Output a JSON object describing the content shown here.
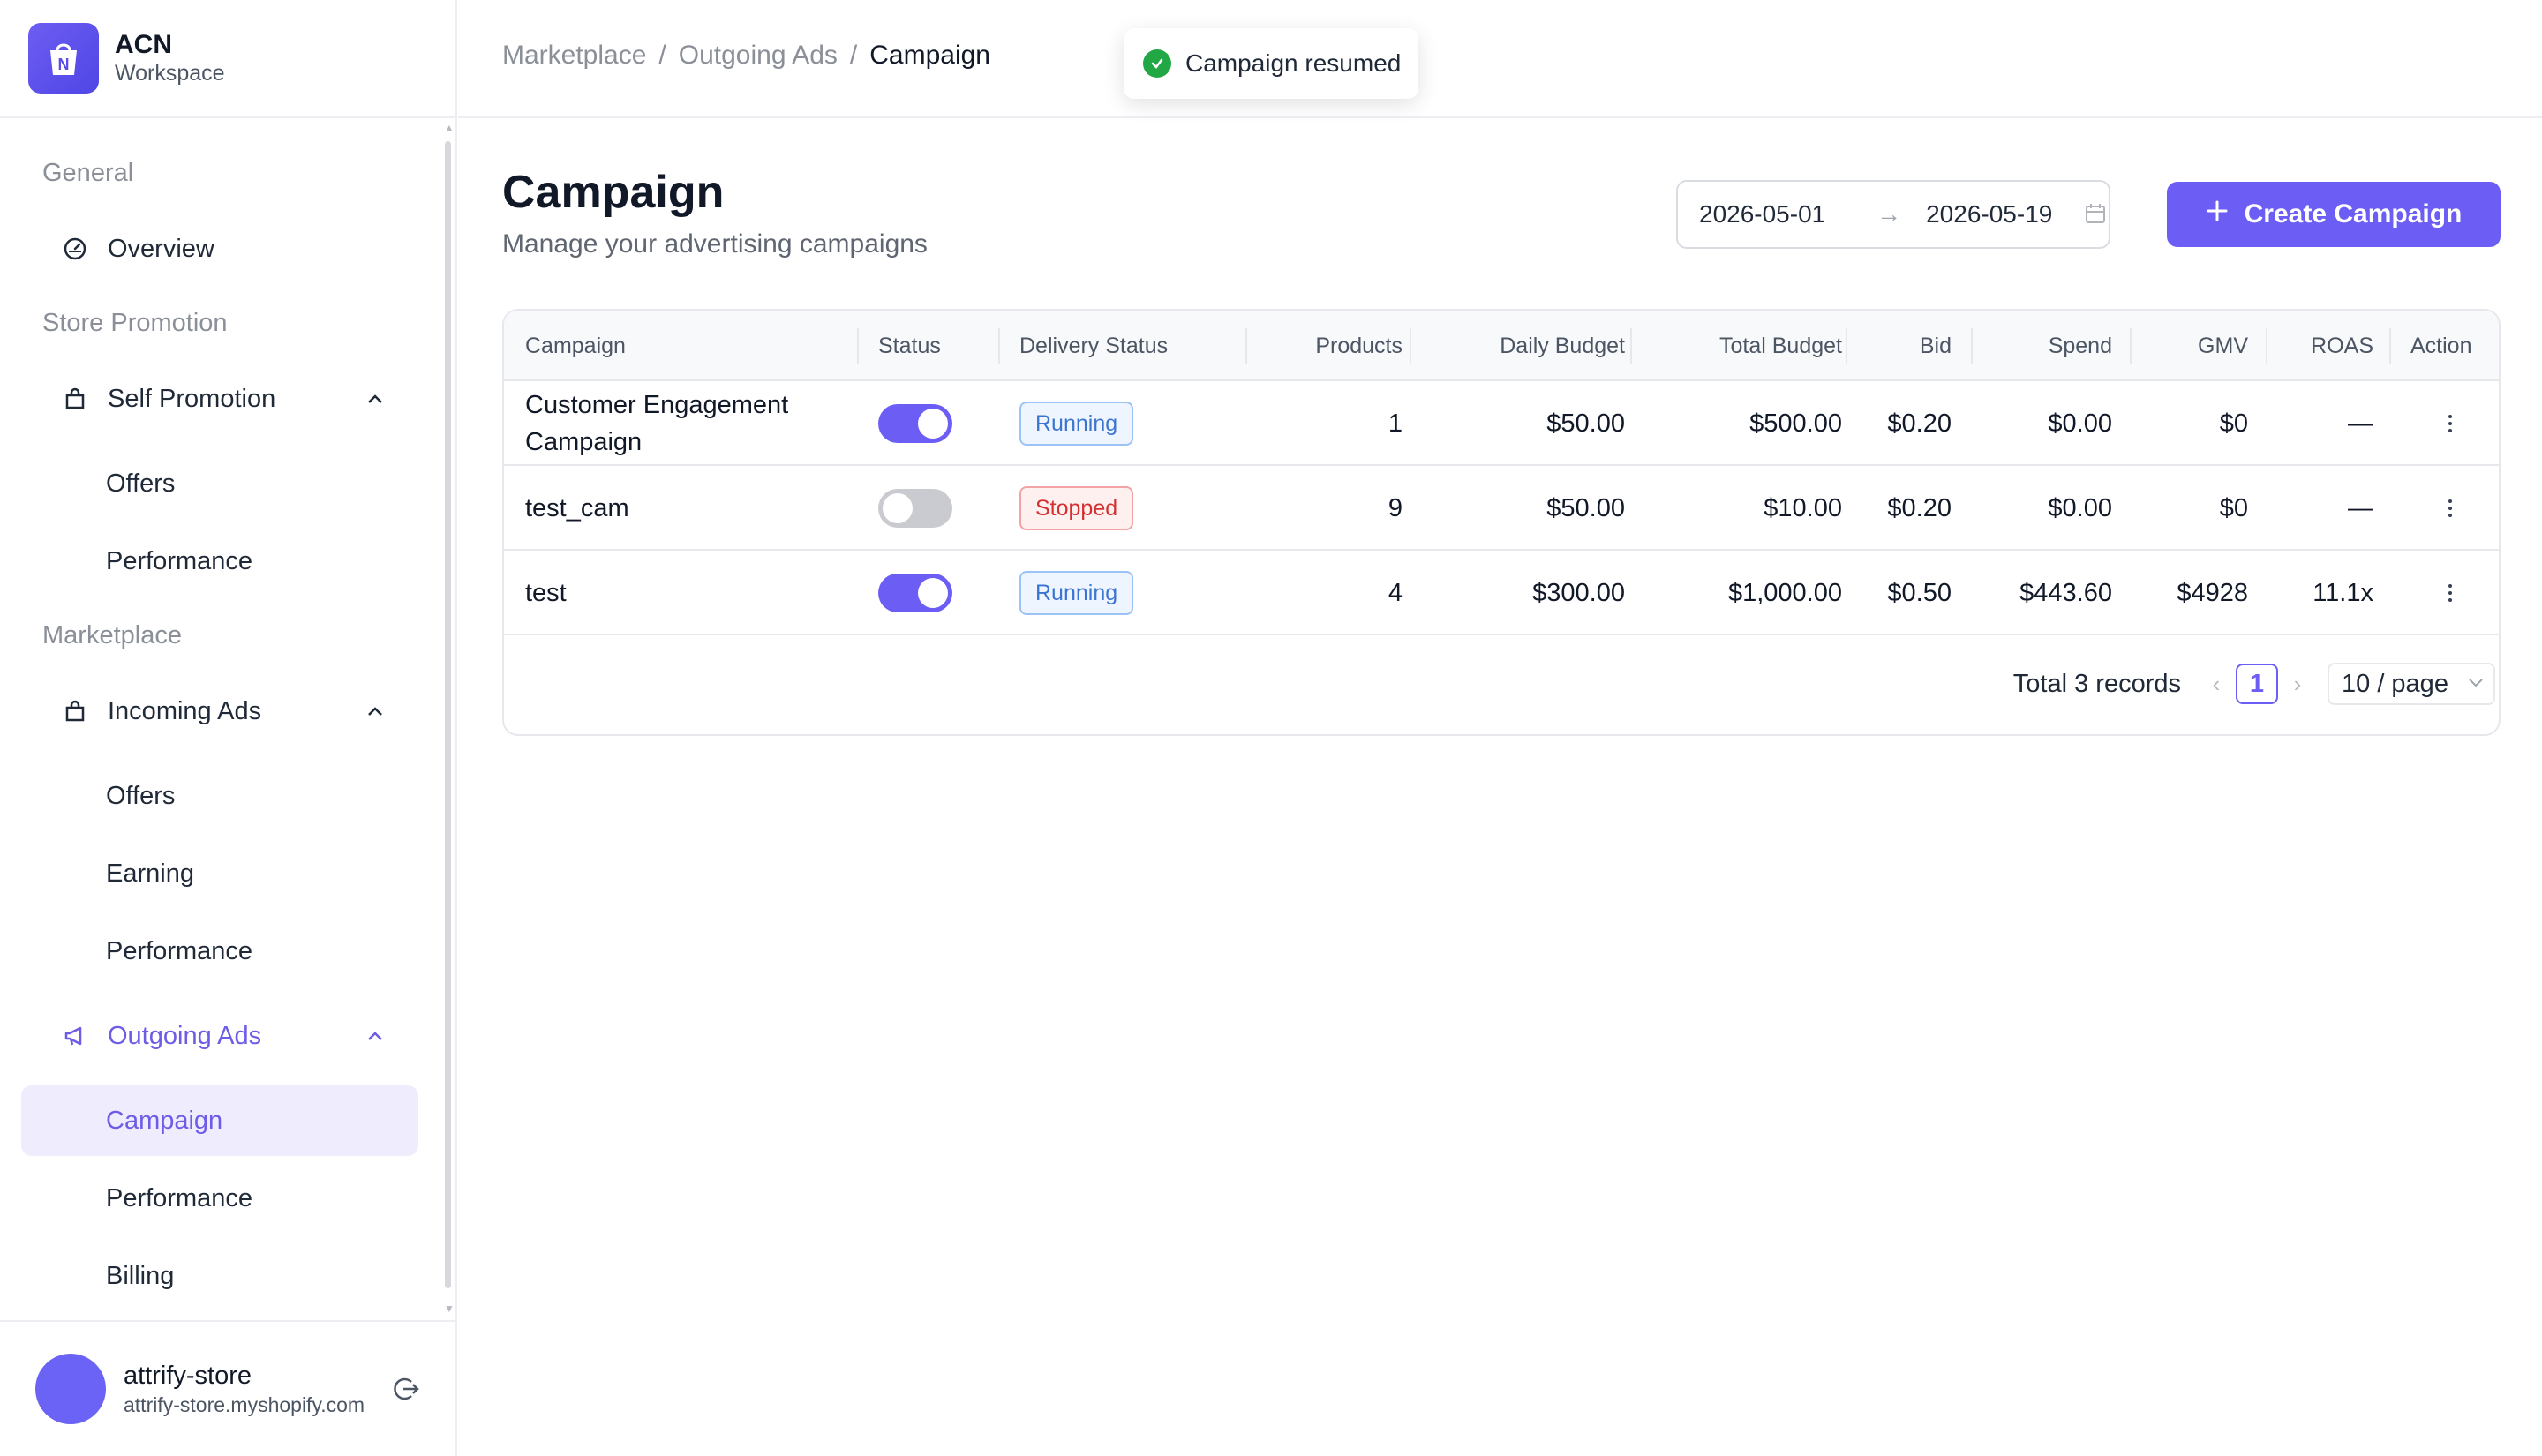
{
  "brand": {
    "title": "ACN",
    "subtitle": "Workspace"
  },
  "sidebar": {
    "sections": {
      "general": "General",
      "store_promotion": "Store Promotion",
      "marketplace": "Marketplace"
    },
    "items": {
      "overview": "Overview",
      "self_promotion": "Self Promotion",
      "self_offers": "Offers",
      "self_performance": "Performance",
      "incoming_ads": "Incoming Ads",
      "incoming_offers": "Offers",
      "incoming_earning": "Earning",
      "incoming_performance": "Performance",
      "outgoing_ads": "Outgoing Ads",
      "outgoing_campaign": "Campaign",
      "outgoing_performance": "Performance",
      "outgoing_billing": "Billing"
    }
  },
  "user": {
    "name": "attrify-store",
    "domain": "attrify-store.myshopify.com"
  },
  "breadcrumb": {
    "items": [
      "Marketplace",
      "Outgoing Ads"
    ],
    "current": "Campaign",
    "separator": "/"
  },
  "toast": {
    "message": "Campaign resumed"
  },
  "page": {
    "title": "Campaign",
    "subtitle": "Manage your advertising campaigns"
  },
  "date_range": {
    "start": "2026-05-01",
    "end": "2026-05-19",
    "separator": "→"
  },
  "create_button": {
    "label": "Create Campaign"
  },
  "table": {
    "headers": [
      "Campaign",
      "Status",
      "Delivery Status",
      "Products",
      "Daily Budget",
      "Total Budget",
      "Bid",
      "Spend",
      "GMV",
      "ROAS",
      "Action"
    ],
    "rows": [
      {
        "campaign": "Customer Engagement Campaign",
        "status_on": true,
        "delivery": "Running",
        "products": "1",
        "daily_budget": "$50.00",
        "total_budget": "$500.00",
        "bid": "$0.20",
        "spend": "$0.00",
        "gmv": "$0",
        "roas": "—"
      },
      {
        "campaign": "test_cam",
        "status_on": false,
        "delivery": "Stopped",
        "products": "9",
        "daily_budget": "$50.00",
        "total_budget": "$10.00",
        "bid": "$0.20",
        "spend": "$0.00",
        "gmv": "$0",
        "roas": "—"
      },
      {
        "campaign": "test",
        "status_on": true,
        "delivery": "Running",
        "products": "4",
        "daily_budget": "$300.00",
        "total_budget": "$1,000.00",
        "bid": "$0.50",
        "spend": "$443.60",
        "gmv": "$4928",
        "roas": "11.1x"
      }
    ]
  },
  "pagination": {
    "total_label": "Total 3 records",
    "current_page": "1",
    "page_size": "10 / page"
  },
  "colors": {
    "accent": "#6c5ef5",
    "running": "#3b74d1",
    "stopped": "#d33131",
    "success": "#22a745"
  }
}
